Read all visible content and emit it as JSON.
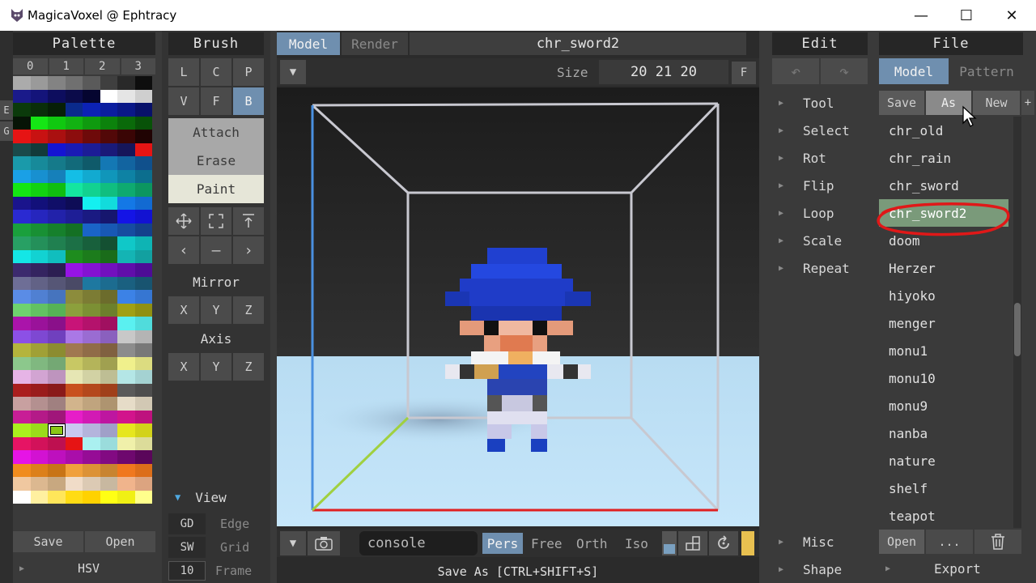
{
  "window": {
    "title": "MagicaVoxel @ Ephtracy",
    "min": "—",
    "max": "☐",
    "close": "✕"
  },
  "palette": {
    "header": "Palette",
    "tabs": [
      "0",
      "1",
      "2",
      "3"
    ],
    "side_tabs": [
      "E",
      "G"
    ],
    "save": "Save",
    "open": "Open",
    "hsv": "HSV",
    "colors": [
      [
        "#ababab",
        "#9a9a9a",
        "#838383",
        "#707070",
        "#5a5a5a",
        "#3f3f3f",
        "#292929",
        "#0e0e0e"
      ],
      [
        "#1a1a8a",
        "#14147a",
        "#0d0d5e",
        "#0b0b4a",
        "#050530",
        "#ffffff",
        "#e5e5e5",
        "#cfcfcf"
      ],
      [
        "#0b3a0b",
        "#0a2e0a",
        "#071f07",
        "#0a2a8c",
        "#0c22b5",
        "#0b1ea0",
        "#0a1888",
        "#08116a"
      ],
      [
        "#061406",
        "#15e615",
        "#10c810",
        "#12b212",
        "#0f9a0f",
        "#0c820c",
        "#0a6a0a",
        "#085208"
      ],
      [
        "#e61414",
        "#c81212",
        "#aa1010",
        "#8c0d0d",
        "#6e0a0a",
        "#520808",
        "#3a0505",
        "#200303"
      ],
      [
        "#1a4a4a",
        "#123a3a",
        "#1414d2",
        "#1a1ab4",
        "#1c1c96",
        "#1a1a78",
        "#16165a",
        "#e61414"
      ],
      [
        "#1a9aaa",
        "#178a9a",
        "#157a8a",
        "#126a7a",
        "#0f5a6a",
        "#1478b4",
        "#1264a0",
        "#10508c"
      ],
      [
        "#1aa0e6",
        "#1890d0",
        "#1680ba",
        "#14bee6",
        "#12aad0",
        "#1096ba",
        "#0e82a4",
        "#0c6e8e"
      ],
      [
        "#14e614",
        "#12d212",
        "#10be10",
        "#14e6a0",
        "#12d290",
        "#10be80",
        "#0eaa70",
        "#0c9660"
      ],
      [
        "#1a148c",
        "#12107a",
        "#100e68",
        "#0e0c56",
        "#14f0f0",
        "#12dcdc",
        "#1478e6",
        "#126ad2"
      ],
      [
        "#2a2ad2",
        "#2626be",
        "#2222aa",
        "#1e1e96",
        "#1a1a82",
        "#16166e",
        "#1414e6",
        "#1212d2"
      ],
      [
        "#1aa03c",
        "#189034",
        "#16802c",
        "#147024",
        "#1a64c8",
        "#1858b4",
        "#164ca0",
        "#14408c"
      ],
      [
        "#28a064",
        "#24905a",
        "#208050",
        "#1c7046",
        "#18603c",
        "#145032",
        "#10c8c8",
        "#0eb4b4"
      ],
      [
        "#14e6e6",
        "#12d2d2",
        "#10bebe",
        "#1e8c1e",
        "#1c7c1c",
        "#1a6c1a",
        "#14b4b4",
        "#12a0a0"
      ],
      [
        "#3c2a6e",
        "#342460",
        "#2c1e52",
        "#9614e6",
        "#8412d2",
        "#7210be",
        "#600eaa",
        "#4e0c96"
      ],
      [
        "#6e6e96",
        "#626286",
        "#565676",
        "#4a4a66",
        "#1e78a0",
        "#1c6c90",
        "#1a6080",
        "#185470"
      ],
      [
        "#5a8ce6",
        "#5080d2",
        "#4674be",
        "#8c8c3c",
        "#7c7c34",
        "#6c6c2c",
        "#3c82e6",
        "#3676d2"
      ],
      [
        "#6ed26e",
        "#62c262",
        "#56b256",
        "#8ca03c",
        "#7c9034",
        "#6c802c",
        "#a0a014",
        "#909012"
      ],
      [
        "#aa14aa",
        "#9a129a",
        "#8a108a",
        "#c81478",
        "#b4126c",
        "#a01060",
        "#5af0f0",
        "#50dcdc"
      ],
      [
        "#8c50e6",
        "#7e48d2",
        "#7040be",
        "#aa78e6",
        "#9a6cd2",
        "#8a60be",
        "#c8c8c8",
        "#b4b4b4"
      ],
      [
        "#b4b43c",
        "#a0a036",
        "#8c8c30",
        "#a07850",
        "#906c48",
        "#806040",
        "#8c8c8c",
        "#787878"
      ],
      [
        "#8cc88c",
        "#80b880",
        "#74a874",
        "#c8c864",
        "#b4b45a",
        "#a0a050",
        "#f0f08c",
        "#dcdc80"
      ],
      [
        "#e6b4e6",
        "#d2a4d2",
        "#be94be",
        "#e6e6b4",
        "#d2d2a4",
        "#bebe94",
        "#b4e6e6",
        "#a4d2d2"
      ],
      [
        "#aa1e1e",
        "#9a1c1c",
        "#8a1a1a",
        "#c8501e",
        "#b4481c",
        "#a0401a",
        "#5a5a5a",
        "#4e4e4e"
      ],
      [
        "#c8a0a0",
        "#b49090",
        "#a08080",
        "#d2b48c",
        "#c0a47e",
        "#ae9470",
        "#e6dcc8",
        "#d2c8b4"
      ],
      [
        "#c81e96",
        "#b41a88",
        "#a0167a",
        "#e61ec8",
        "#d21ab4",
        "#be16a0",
        "#d2148c",
        "#be127e"
      ],
      [
        "#aaf01e",
        "#9adc1a",
        "#8ac816",
        "#c8c8f0",
        "#b4b4dc",
        "#a0a0c8",
        "#e6e61e",
        "#d2d21a"
      ],
      [
        "#e61464",
        "#d2125a",
        "#be1050",
        "#e61414",
        "#aaf0f0",
        "#9adcdc",
        "#f0f0aa",
        "#dcdc9a"
      ],
      [
        "#e614e6",
        "#d212d2",
        "#be10be",
        "#aa0eaa",
        "#960c96",
        "#820a82",
        "#6e086e",
        "#5a065a"
      ],
      [
        "#f08c1e",
        "#dc801a",
        "#c87416",
        "#f0a03c",
        "#dc9236",
        "#c88430",
        "#f0781e",
        "#dc6e1a"
      ],
      [
        "#f0c8a0",
        "#dcb890",
        "#c8a880",
        "#f0dcc8",
        "#dccab4",
        "#c8b8a0",
        "#f0b48c",
        "#dca480"
      ],
      [
        "#ffffff",
        "#fff0a0",
        "#ffe65a",
        "#ffdc14",
        "#ffd200",
        "#ffff14",
        "#f0f014",
        "#ffff8c"
      ]
    ]
  },
  "brush": {
    "header": "Brush",
    "modes_row1": [
      "L",
      "C",
      "P"
    ],
    "modes_row2": [
      "V",
      "F",
      "B"
    ],
    "actions": [
      "Attach",
      "Erase",
      "Paint"
    ],
    "mirror_label": "Mirror",
    "axis_label": "Axis",
    "mirror": [
      "X",
      "Y",
      "Z"
    ],
    "axis": [
      "X",
      "Y",
      "Z"
    ],
    "view_label": "View",
    "view_rows": [
      [
        "GD",
        "Edge"
      ],
      [
        "SW",
        "Grid"
      ],
      [
        "10",
        "Frame"
      ]
    ]
  },
  "viewport": {
    "tabs": [
      "Model",
      "Render"
    ],
    "model_name": "chr_sword2",
    "size_label": "Size",
    "size_value": "20 21 20",
    "fit_button": "F",
    "console_placeholder": "console",
    "projections": [
      "Pers",
      "Free",
      "Orth",
      "Iso"
    ],
    "status": "Save As [CTRL+SHIFT+S]"
  },
  "edit": {
    "header": "Edit",
    "items": [
      "Tool",
      "Select",
      "Rot",
      "Flip",
      "Loop",
      "Scale",
      "Repeat"
    ],
    "bottom_items": [
      "Misc",
      "Shape"
    ]
  },
  "file": {
    "header": "File",
    "tabs": [
      "Model",
      "Pattern"
    ],
    "actions": [
      "Save",
      "As",
      "New",
      "+"
    ],
    "files": [
      "chr_old",
      "chr_rain",
      "chr_sword",
      "chr_sword2",
      "doom",
      "Herzer",
      "hiyoko",
      "menger",
      "monu1",
      "monu10",
      "monu9",
      "nanba",
      "nature",
      "shelf",
      "teapot"
    ],
    "selected": "chr_sword2",
    "bottom": [
      "Open",
      "...",
      "trash"
    ],
    "export": "Export"
  }
}
